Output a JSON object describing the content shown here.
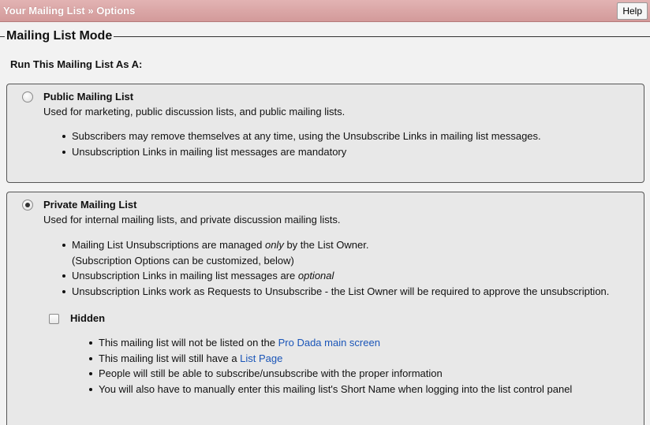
{
  "header": {
    "title": "Your Mailing List » Options",
    "help_label": "Help"
  },
  "section": {
    "legend": "Mailing List Mode",
    "run_label": "Run This Mailing List As A:"
  },
  "public_option": {
    "title": "Public Mailing List",
    "description": "Used for marketing, public discussion lists, and public mailing lists.",
    "selected": false,
    "bullets": [
      "Subscribers may remove themselves at any time, using the Unsubscribe Links in mailing list messages.",
      "Unsubscription Links in mailing list messages are mandatory"
    ]
  },
  "private_option": {
    "title": "Private Mailing List",
    "description": "Used for internal mailing lists, and private discussion mailing lists.",
    "selected": true,
    "bullet1_pre": "Mailing List Unsubscriptions are managed ",
    "bullet1_em": "only",
    "bullet1_post": " by the List Owner.",
    "bullet1_line2": "(Subscription Options can be customized, below)",
    "bullet2_pre": "Unsubscription Links in mailing list messages are ",
    "bullet2_em": "optional",
    "bullet3": "Unsubscription Links work as Requests to Unsubscribe - the List Owner will be required to approve the unsubscription."
  },
  "hidden_option": {
    "label": "Hidden",
    "checked": false,
    "b1_pre": "This mailing list will not be listed on the ",
    "b1_link": "Pro Dada main screen",
    "b2_pre": "This mailing list will still have a ",
    "b2_link": "List Page",
    "b3": "People will still be able to subscribe/unsubscribe with the proper information",
    "b4": "You will also have to manually enter this mailing list's Short Name when logging into the list control panel"
  }
}
